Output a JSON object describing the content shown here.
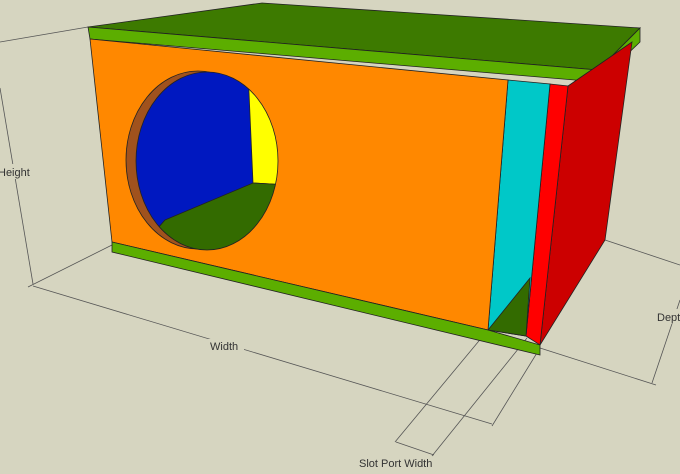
{
  "labels": {
    "height": "Height",
    "width": "Width",
    "depth": "Dept",
    "slot_port_width": "Slot Port Width"
  },
  "colors": {
    "background": "#d6d5c0",
    "front_panel": "#ff8800",
    "top_panel": "#3d7a00",
    "edge_green": "#5cae00",
    "slot_port": "#00c8c8",
    "side_panel": "#cc0000",
    "side_edge": "#ff0000",
    "hole_interior": "#0018c0",
    "hole_wall": "#ffff00",
    "hole_floor": "#336b00"
  }
}
